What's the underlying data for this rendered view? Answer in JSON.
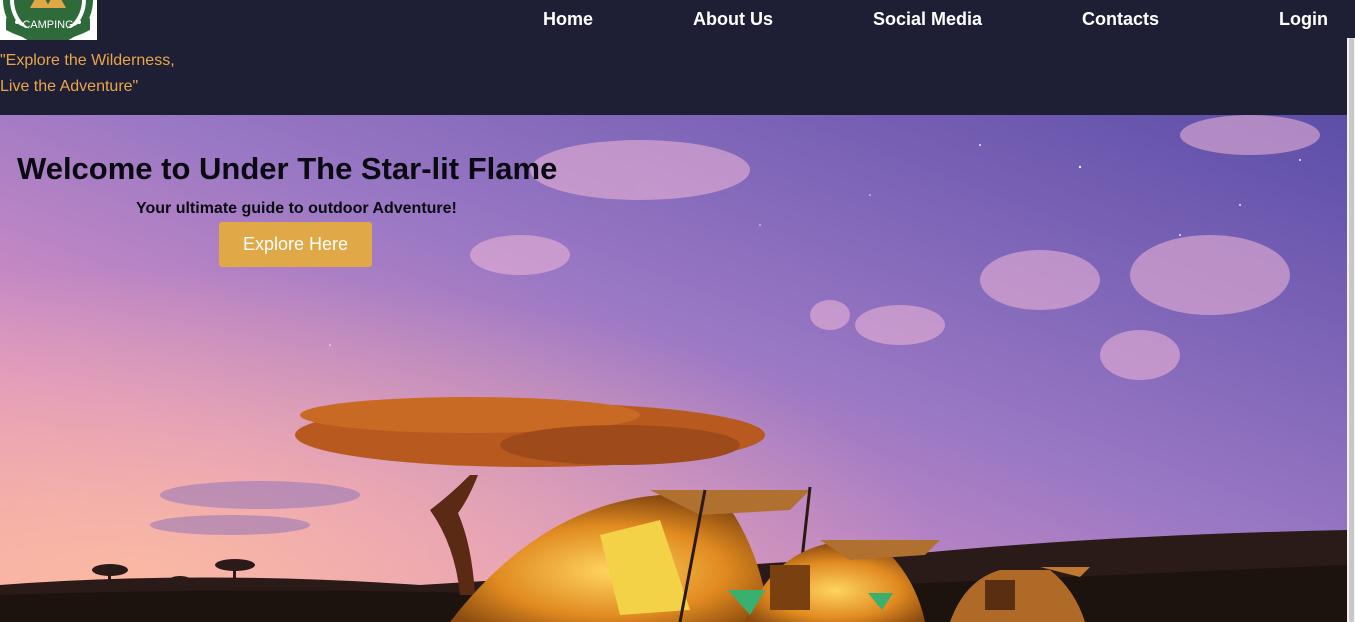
{
  "header": {
    "logo": {
      "text": "CAMPING",
      "icon": "camping-logo-icon"
    },
    "tagline": {
      "line1": "\"Explore the Wilderness,",
      "line2": "Live the Adventure\""
    },
    "nav": [
      {
        "label": "Home"
      },
      {
        "label": "About Us"
      },
      {
        "label": "Social Media"
      },
      {
        "label": "Contacts"
      },
      {
        "label": "Login"
      }
    ]
  },
  "hero": {
    "title": "Welcome to Under The Star-lit Flame",
    "subtitle": "Your ultimate guide to outdoor Adventure!",
    "cta_label": "Explore Here",
    "background": "night-sky-camping-tents-image"
  },
  "colors": {
    "header_bg": "#1e1f35",
    "accent": "#e0a846",
    "tagline": "#e8a64a",
    "nav_text": "#ffffff"
  }
}
